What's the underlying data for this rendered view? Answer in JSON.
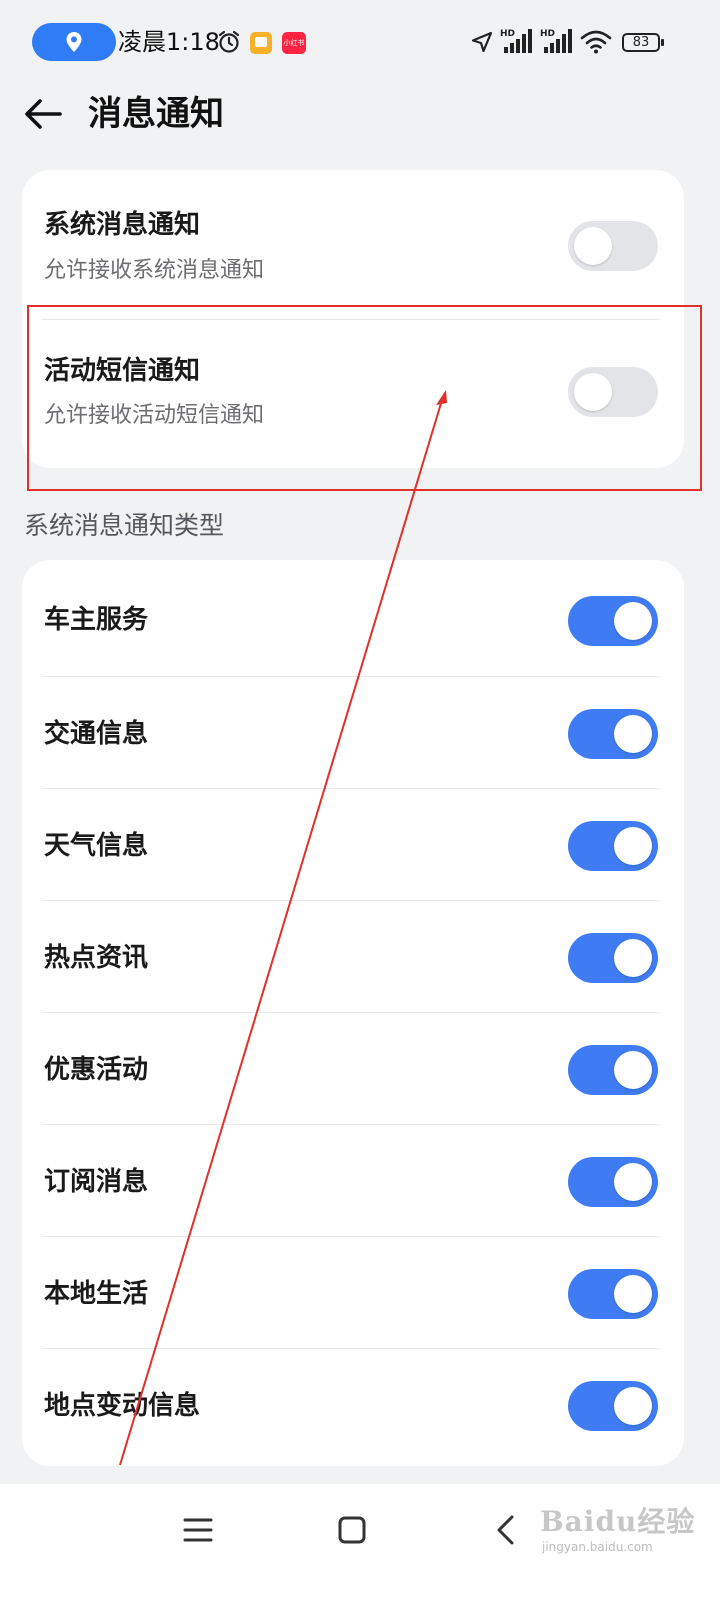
{
  "status_bar": {
    "time": "凌晨1:18",
    "battery": "83",
    "signal_label_1": "HD",
    "signal_label_2": "HD",
    "app_icon_label": "小红书"
  },
  "header": {
    "title": "消息通知"
  },
  "top_card": {
    "rows": [
      {
        "title": "系统消息通知",
        "subtitle": "允许接收系统消息通知",
        "enabled": false
      },
      {
        "title": "活动短信通知",
        "subtitle": "允许接收活动短信通知",
        "enabled": false
      }
    ]
  },
  "types_section": {
    "header": "系统消息通知类型",
    "rows": [
      {
        "title": "车主服务",
        "enabled": true
      },
      {
        "title": "交通信息",
        "enabled": true
      },
      {
        "title": "天气信息",
        "enabled": true
      },
      {
        "title": "热点资讯",
        "enabled": true
      },
      {
        "title": "优惠活动",
        "enabled": true
      },
      {
        "title": "订阅消息",
        "enabled": true
      },
      {
        "title": "本地生活",
        "enabled": true
      },
      {
        "title": "地点变动信息",
        "enabled": true
      }
    ]
  },
  "colors": {
    "toggle_on": "#3f7cf3",
    "toggle_off": "#e3e4e7",
    "annotation": "#e0302a",
    "location_pill": "#2f7cf6"
  },
  "watermark": {
    "brand": "Baidu经验",
    "url": "jingyan.baidu.com"
  }
}
